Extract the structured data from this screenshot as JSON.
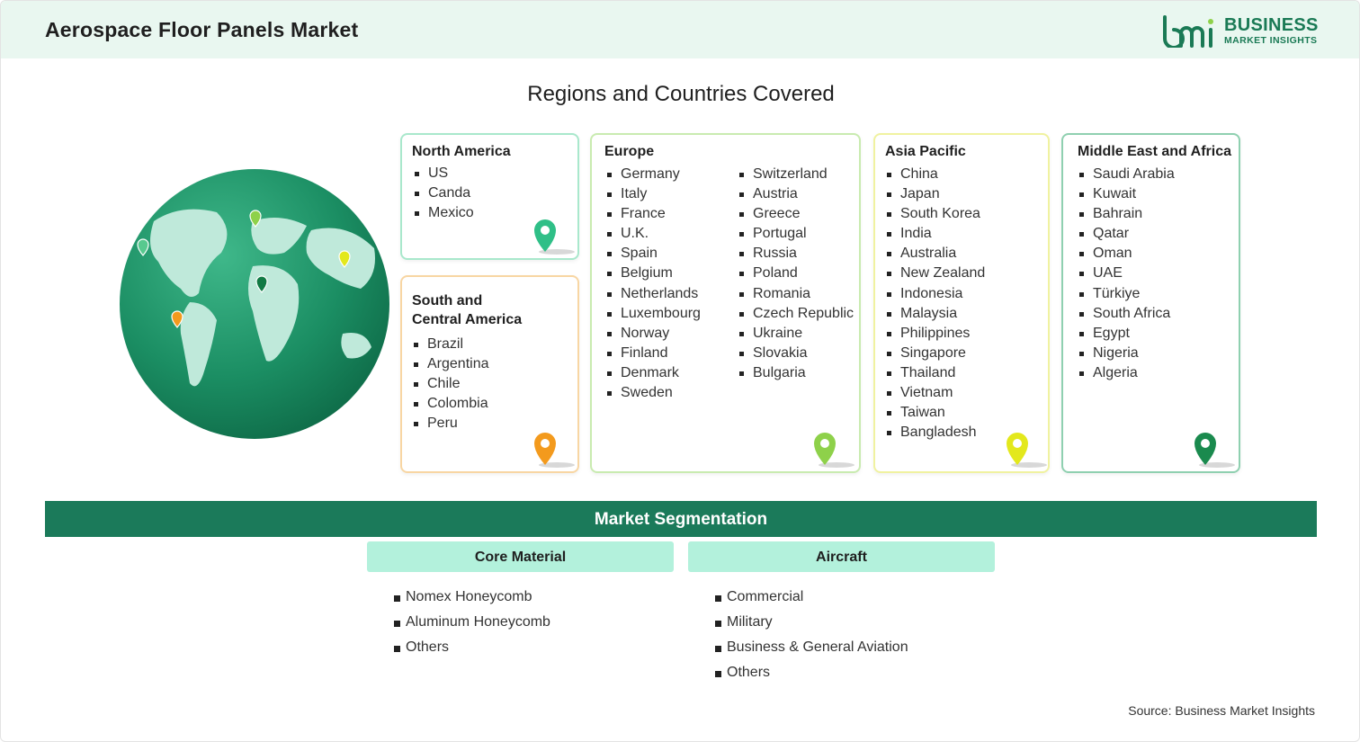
{
  "header": {
    "title": "Aerospace Floor Panels Market",
    "logo_line1": "BUSINESS",
    "logo_line2": "MARKET INSIGHTS"
  },
  "regions_title": "Regions and Countries Covered",
  "regions": {
    "north_america": {
      "title": "North America",
      "items": [
        "US",
        "Canda",
        "Mexico"
      ],
      "color": "#2fbf87"
    },
    "south_america": {
      "title_line1": "South and",
      "title_line2": "Central America",
      "items": [
        "Brazil",
        "Argentina",
        "Chile",
        "Colombia",
        "Peru"
      ],
      "color": "#f39a1d"
    },
    "europe": {
      "title": "Europe",
      "col1": [
        "Germany",
        "Italy",
        "France",
        "U.K.",
        "Spain",
        "Belgium",
        "Netherlands",
        "Luxembourg",
        "Norway",
        "Finland",
        "Denmark",
        "Sweden"
      ],
      "col2": [
        "Switzerland",
        "Austria",
        "Greece",
        "Portugal",
        "Russia",
        "Poland",
        "Romania",
        "Czech Republic",
        "Ukraine",
        "Slovakia",
        "Bulgaria"
      ],
      "color": "#8ed14a"
    },
    "asia_pacific": {
      "title": "Asia Pacific",
      "items": [
        "China",
        "Japan",
        "South Korea",
        "India",
        "Australia",
        "New Zealand",
        "Indonesia",
        "Malaysia",
        "Philippines",
        "Singapore",
        "Thailand",
        "Vietnam",
        "Taiwan",
        "Bangladesh"
      ],
      "color": "#e3e81c"
    },
    "mea": {
      "title": "Middle East and Africa",
      "items": [
        "Saudi Arabia",
        "Kuwait",
        "Bahrain",
        "Qatar",
        "Oman",
        "UAE",
        "Türkiye",
        "South Africa",
        "Egypt",
        "Nigeria",
        "Algeria"
      ],
      "color": "#1a8a4e"
    }
  },
  "segmentation": {
    "title": "Market Segmentation",
    "core_material": {
      "title": "Core Material",
      "items": [
        "Nomex Honeycomb",
        "Aluminum Honeycomb",
        "Others"
      ]
    },
    "aircraft": {
      "title": "Aircraft",
      "items": [
        "Commercial",
        "Military",
        "Business & General Aviation",
        "Others"
      ]
    }
  },
  "source": "Source: Business Market Insights",
  "colors": {
    "brand_green": "#1b7a5a",
    "header_bg": "#e9f7f0",
    "seg_head_bg": "#b3f1dc"
  }
}
